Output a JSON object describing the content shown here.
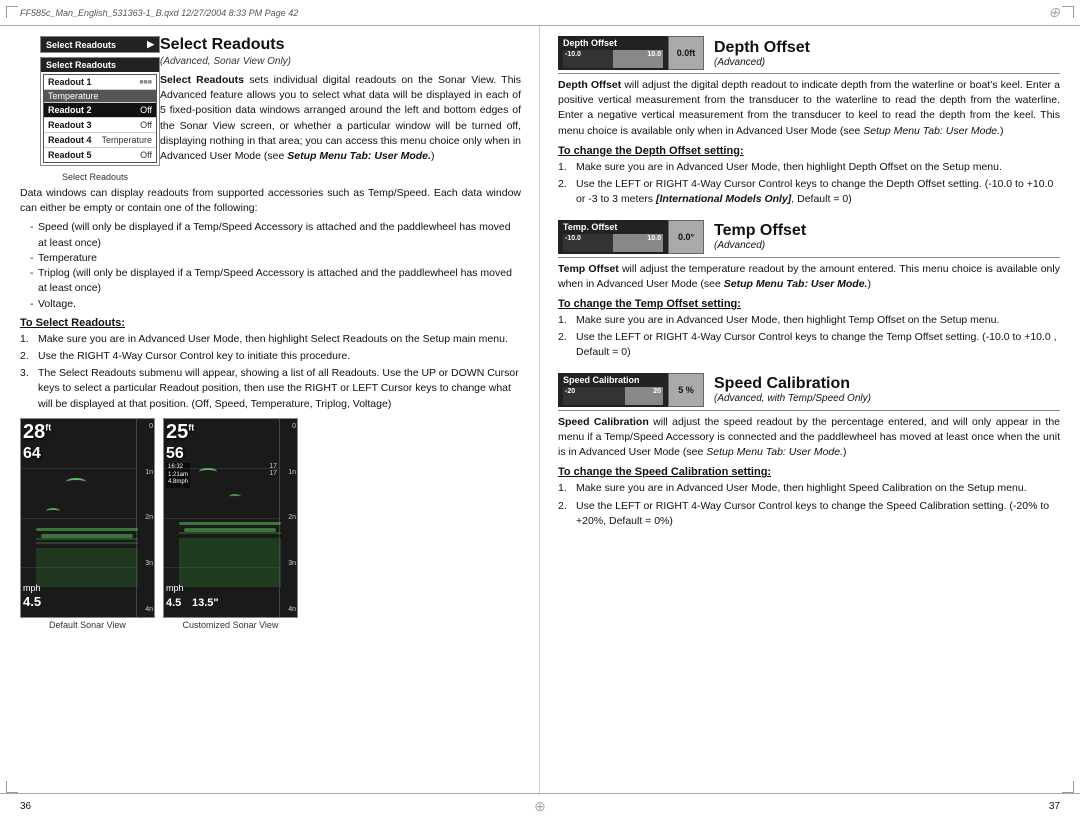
{
  "header": {
    "text": "FF585c_Man_English_531363-1_B.qxd   12/27/2004   8:33 PM   Page 42"
  },
  "footer": {
    "left_page": "36",
    "right_page": "37"
  },
  "left_column": {
    "section_title": "Select Readouts",
    "section_subtitle": "(Advanced, Sonar View Only)",
    "menu_box": {
      "header": "Select Readouts",
      "items": [
        {
          "label": "Readout 1",
          "value": "Temperature",
          "selected": false
        },
        {
          "label": "Readout 2",
          "value": "Off",
          "selected": true
        },
        {
          "label": "Readout 3",
          "value": "Off",
          "selected": false
        },
        {
          "label": "Readout 4",
          "value": "Temperature",
          "selected": false
        },
        {
          "label": "Readout 5",
          "value": "Off",
          "selected": false
        }
      ],
      "label": "Select Readouts"
    },
    "body_paragraphs": [
      "Select Readouts sets individual digital readouts on the Sonar View. This Advanced feature allows you to select what data will be displayed in each of 5 fixed-position data windows arranged around the left and bottom edges of the Sonar View screen, or whether a particular window will be turned off, displaying nothing in that area; you can access this menu choice only when in Advanced User Mode (see Setup Menu Tab: User Mode.)",
      "Data windows can display readouts from supported accessories such as Temp/Speed. Each data window can either be empty or contain one of the following:"
    ],
    "bullets": [
      "Speed (will only be displayed if a Temp/Speed Accessory is attached and the paddlewheel has moved at least once)",
      "Temperature",
      "Triplog (will only be displayed if a Temp/Speed Accessory is attached and the paddlewheel has moved at least once)",
      "Voltage."
    ],
    "to_select_title": "To Select Readouts:",
    "to_select_steps": [
      "Make sure you are in Advanced User Mode, then highlight Select Readouts on the Setup main menu.",
      "Use the RIGHT 4-Way Cursor Control key to initiate this procedure.",
      "The Select Readouts submenu will appear, showing a list of all Readouts. Use the UP or DOWN Cursor keys to select a particular Readout position, then use the RIGHT or LEFT Cursor keys to change what will be displayed at that position. (Off, Speed, Temperature, Triplog, Voltage)"
    ],
    "sonar_views": [
      {
        "label": "Default Sonar View",
        "big_num": "28",
        "superscript": "ft",
        "mid_num": "64",
        "speed_label": "mph",
        "speed_val": "4.5",
        "depth_marks": [
          "0",
          "1n",
          "2n",
          "3n",
          "4n"
        ]
      },
      {
        "label": "Customized Sonar View",
        "big_num": "25",
        "superscript": "ft",
        "mid_num": "56",
        "speed_label": "mph",
        "speed_val": "4.5",
        "extra_val": "13.5\"",
        "depth_marks": [
          "0",
          "1n",
          "2n",
          "3n",
          "4n"
        ]
      }
    ]
  },
  "right_column": {
    "sections": [
      {
        "id": "depth_offset",
        "control_label": "Depth Offset",
        "control_value": "0.0ft",
        "slider_min": "-10.0",
        "slider_max": "10.0",
        "slider_fill_pct": 50,
        "title": "Depth Offset",
        "subtitle": "(Advanced)",
        "body": "Depth Offset will adjust the digital depth readout to indicate depth from the waterline or boat's keel. Enter a positive vertical measurement from the transducer to the waterline to read the depth from the waterline. Enter a negative vertical measurement from the transducer to keel to read the depth from the keel. This menu choice is available only when in Advanced User Mode (see Setup Menu Tab: User Mode.)",
        "change_title": "To change the Depth Offset setting:",
        "steps": [
          "Make sure you are in Advanced User Mode, then highlight Depth Offset on the Setup menu.",
          "Use the LEFT or RIGHT 4-Way Cursor Control keys to change the Depth Offset setting. (-10.0 to +10.0 or -3 to 3 meters [International Models Only], Default = 0)"
        ]
      },
      {
        "id": "temp_offset",
        "control_label": "Temp. Offset",
        "control_value": "0.0°",
        "slider_min": "-10.0",
        "slider_max": "10.0",
        "slider_fill_pct": 50,
        "title": "Temp Offset",
        "subtitle": "(Advanced)",
        "body": "Temp Offset will adjust the temperature readout by the amount entered. This menu choice is available only when in Advanced User Mode (see Setup Menu Tab: User Mode.)",
        "change_title": "To change the Temp Offset setting:",
        "steps": [
          "Make sure you are in Advanced User Mode, then highlight Temp Offset on the Setup menu.",
          "Use the LEFT or RIGHT 4-Way Cursor Control keys to change the Temp Offset setting. (-10.0 to +10.0 , Default = 0)"
        ]
      },
      {
        "id": "speed_calibration",
        "control_label": "Speed Calibration",
        "control_value": "5 %",
        "slider_min": "-20",
        "slider_max": "20",
        "slider_fill_pct": 62,
        "title": "Speed Calibration",
        "subtitle": "(Advanced, with Temp/Speed Only)",
        "body": "Speed Calibration will adjust the speed readout by the percentage entered, and will only appear in the menu if a Temp/Speed Accessory is connected and the paddlewheel has moved at least once when the unit is in Advanced User Mode (see Setup Menu Tab: User Mode.)",
        "change_title": "To change the Speed Calibration setting:",
        "steps": [
          "Make sure you are in Advanced User Mode, then highlight Speed Calibration on the Setup menu.",
          "Use the LEFT or RIGHT 4-Way Cursor Control keys to change the Speed Calibration setting. (-20% to +20%, Default = 0%)"
        ]
      }
    ]
  }
}
